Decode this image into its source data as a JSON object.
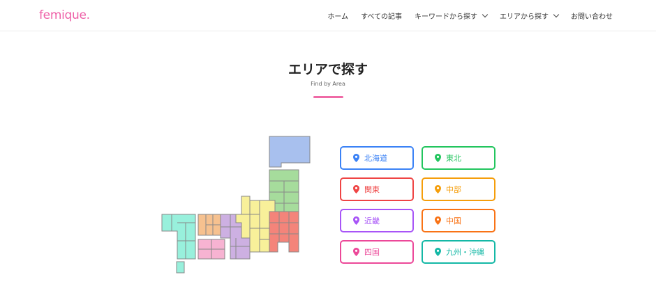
{
  "header": {
    "logo": "femique.",
    "nav": [
      {
        "label": "ホーム",
        "dropdown": false
      },
      {
        "label": "すべての記事",
        "dropdown": false
      },
      {
        "label": "キーワードから探す",
        "dropdown": true
      },
      {
        "label": "エリアから探す",
        "dropdown": true
      },
      {
        "label": "お問い合わせ",
        "dropdown": false
      }
    ]
  },
  "section": {
    "title": "エリアで探す",
    "subtitle": "Find by Area"
  },
  "areas": [
    {
      "label": "北海道",
      "color": "#3b82f6",
      "icon": "location-pin-icon"
    },
    {
      "label": "東北",
      "color": "#22c55e",
      "icon": "location-pin-icon"
    },
    {
      "label": "関東",
      "color": "#ef4444",
      "icon": "location-pin-icon"
    },
    {
      "label": "中部",
      "color": "#f59e0b",
      "icon": "location-pin-icon"
    },
    {
      "label": "近畿",
      "color": "#a855f7",
      "icon": "location-pin-icon"
    },
    {
      "label": "中国",
      "color": "#f97316",
      "icon": "location-pin-icon"
    },
    {
      "label": "四国",
      "color": "#ec4899",
      "icon": "location-pin-icon"
    },
    {
      "label": "九州・沖縄",
      "color": "#14b8a6",
      "icon": "location-pin-icon"
    }
  ],
  "map_colors": {
    "hokkaido": "#a8c0ee",
    "tohoku": "#a6dc9c",
    "kanto": "#f4847a",
    "chubu": "#f8f09a",
    "kinki": "#cdb0e2",
    "chugoku": "#f6c18f",
    "shikoku": "#f7b3d2",
    "kyushu": "#98f0dc"
  },
  "accent": "#ef6aa6"
}
